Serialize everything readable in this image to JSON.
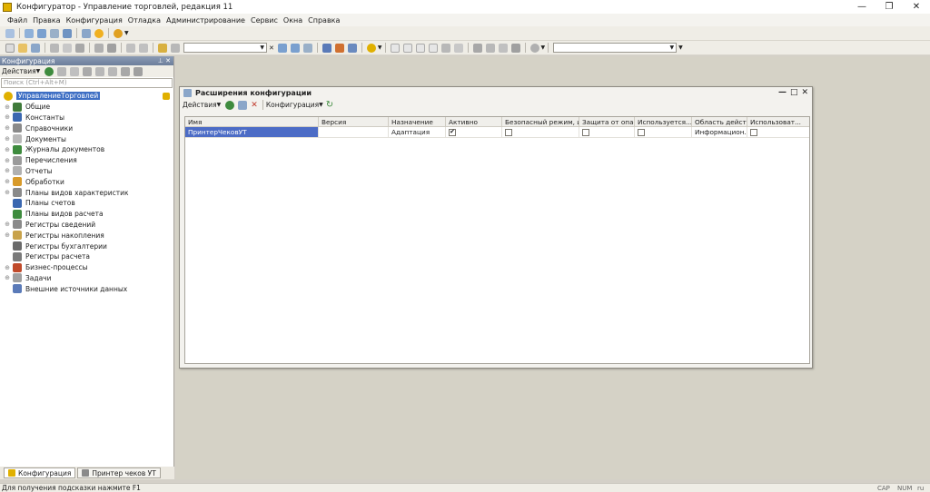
{
  "window": {
    "title": "Конфигуратор - Управление торговлей, редакция 11",
    "controls": {
      "minimize": "—",
      "restore": "❐",
      "close": "✕"
    }
  },
  "menu": [
    "Файл",
    "Правка",
    "Конфигурация",
    "Отладка",
    "Администрирование",
    "Сервис",
    "Окна",
    "Справка"
  ],
  "left_panel": {
    "title": "Конфигурация",
    "actions_label": "Действия",
    "search_placeholder": "Поиск (Ctrl+Alt+M)",
    "root_label": "УправлениеТорговлей",
    "items": [
      {
        "label": "Общие",
        "expandable": true,
        "icon_color": "#3f7a3a"
      },
      {
        "label": "Константы",
        "expandable": true,
        "icon_color": "#3a67b0"
      },
      {
        "label": "Справочники",
        "expandable": true,
        "icon_color": "#8a8a8a"
      },
      {
        "label": "Документы",
        "expandable": true,
        "icon_color": "#b9b9b9"
      },
      {
        "label": "Журналы документов",
        "expandable": true,
        "icon_color": "#3e8b3e"
      },
      {
        "label": "Перечисления",
        "expandable": true,
        "icon_color": "#9a9a9a"
      },
      {
        "label": "Отчеты",
        "expandable": true,
        "icon_color": "#b0b0b0"
      },
      {
        "label": "Обработки",
        "expandable": true,
        "icon_color": "#d89a2a"
      },
      {
        "label": "Планы видов характеристик",
        "expandable": true,
        "icon_color": "#8a8a8a"
      },
      {
        "label": "Планы счетов",
        "expandable": false,
        "icon_color": "#3a67b0"
      },
      {
        "label": "Планы видов расчета",
        "expandable": false,
        "icon_color": "#3e8b3e"
      },
      {
        "label": "Регистры сведений",
        "expandable": true,
        "icon_color": "#8a8a8a"
      },
      {
        "label": "Регистры накопления",
        "expandable": true,
        "icon_color": "#c8a24a"
      },
      {
        "label": "Регистры бухгалтерии",
        "expandable": false,
        "icon_color": "#6a6a6a"
      },
      {
        "label": "Регистры расчета",
        "expandable": false,
        "icon_color": "#7a7a7a"
      },
      {
        "label": "Бизнес-процессы",
        "expandable": true,
        "icon_color": "#c04a2a"
      },
      {
        "label": "Задачи",
        "expandable": true,
        "icon_color": "#a0a0a0"
      },
      {
        "label": "Внешние источники данных",
        "expandable": false,
        "icon_color": "#5a7ab8"
      }
    ],
    "tabs": [
      {
        "label": "Конфигурация",
        "active": true
      },
      {
        "label": "Принтер чеков УТ",
        "active": false
      }
    ]
  },
  "dialog": {
    "title": "Расширения конфигурации",
    "actions_label": "Действия",
    "config_label": "Конфигурация",
    "columns": [
      "Имя",
      "Версия",
      "Назначение",
      "Активно",
      "Безопасный режим, и...",
      "Защита от опас...",
      "Используется...",
      "Область дейст...",
      "Использоват..."
    ],
    "rows": [
      {
        "name": "ПринтерЧековУТ",
        "version": "",
        "purpose": "Адаптация",
        "active": true,
        "safe_mode": false,
        "protection": false,
        "used": false,
        "scope": "Информацион...",
        "use": false
      }
    ]
  },
  "status": {
    "hint": "Для получения подсказки нажмите F1",
    "cap": "CAP",
    "num": "NUM",
    "lang": "ru"
  },
  "colors": {
    "selection": "#4c6cc6",
    "tree_root_selected": "#3e6fc4",
    "panel_header": "#6c7e9b",
    "workspace": "#d5d2c6"
  }
}
